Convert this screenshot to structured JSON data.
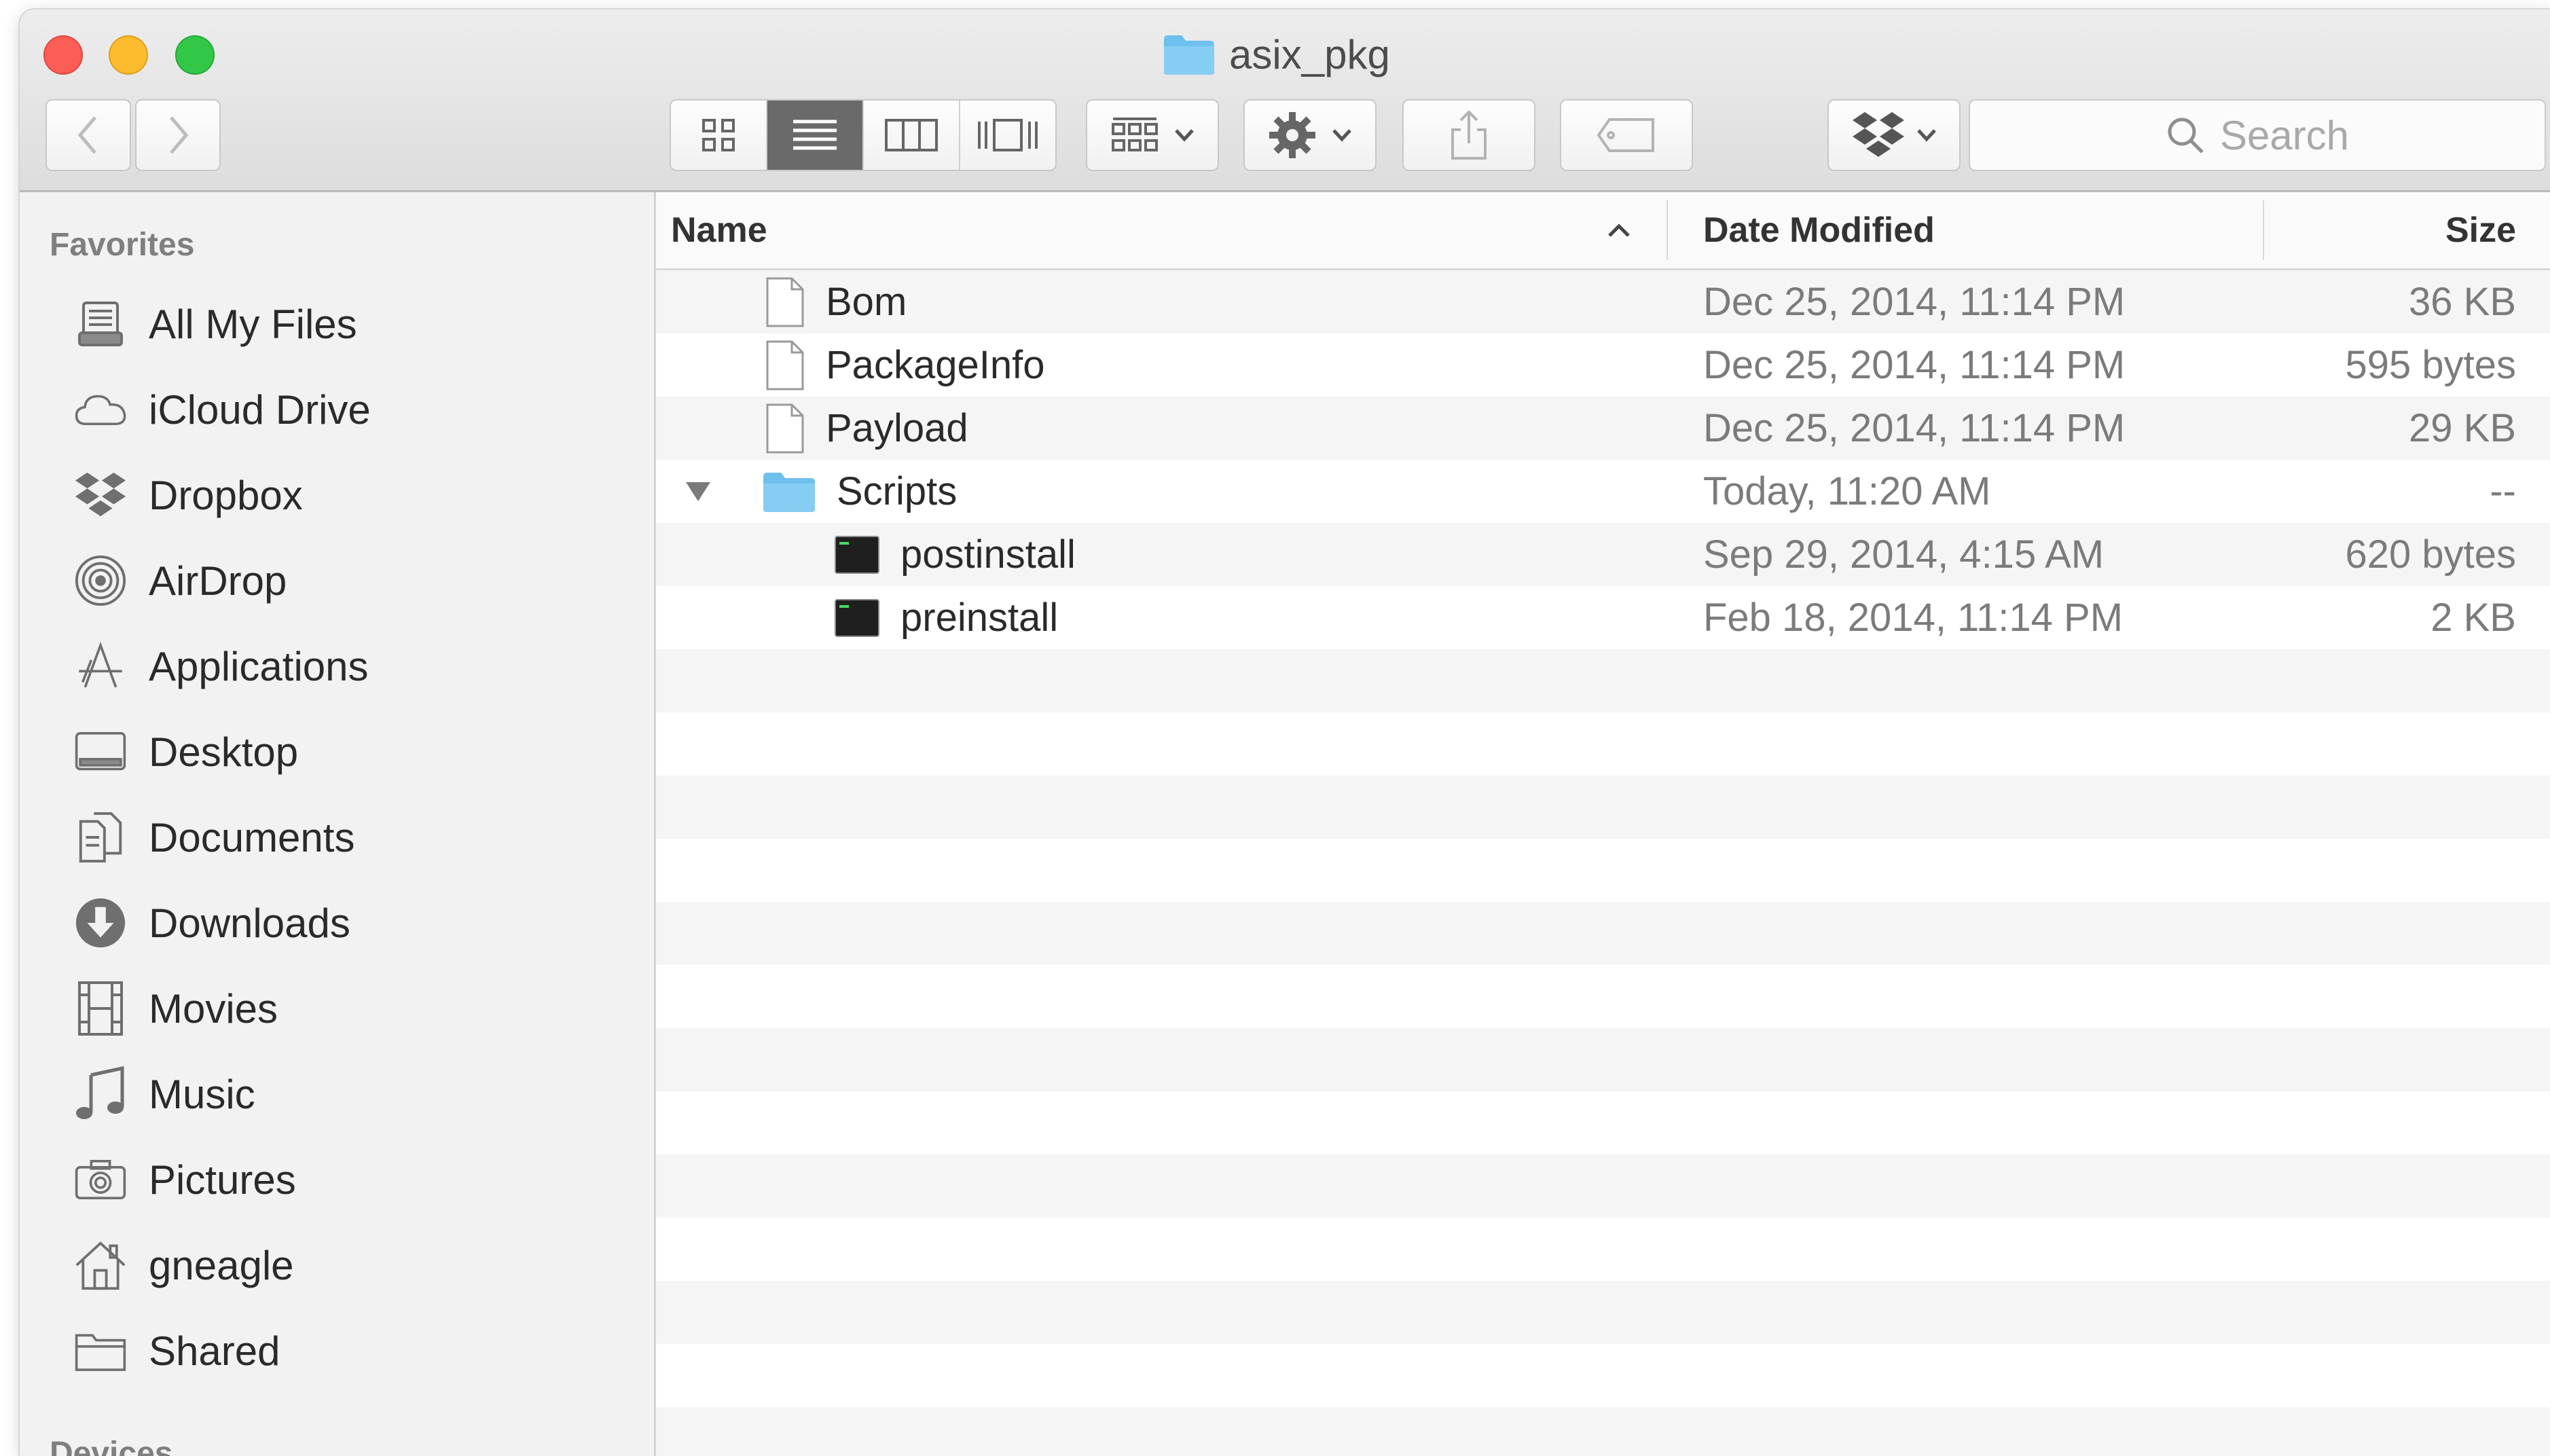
{
  "window": {
    "title": "asix_pkg",
    "folder_icon": "folder-icon",
    "accent_folder_color": "#6ec0ee"
  },
  "toolbar": {
    "back_icon": "chevron-left-icon",
    "forward_icon": "chevron-right-icon",
    "view_modes": [
      "icon-view-icon",
      "list-view-icon",
      "column-view-icon",
      "cover-flow-icon"
    ],
    "active_view": "list-view-icon",
    "arrange_icon": "arrange-icon",
    "action_icon": "gear-icon",
    "share_icon": "share-icon",
    "tag_icon": "tag-icon",
    "dropbox_icon": "dropbox-icon",
    "search_placeholder": "Search"
  },
  "sidebar": {
    "favorites_heading": "Favorites",
    "items": [
      {
        "label": "All My Files",
        "icon": "all-my-files-icon"
      },
      {
        "label": "iCloud Drive",
        "icon": "cloud-icon"
      },
      {
        "label": "Dropbox",
        "icon": "dropbox-icon"
      },
      {
        "label": "AirDrop",
        "icon": "airdrop-icon"
      },
      {
        "label": "Applications",
        "icon": "applications-icon"
      },
      {
        "label": "Desktop",
        "icon": "desktop-icon"
      },
      {
        "label": "Documents",
        "icon": "documents-icon"
      },
      {
        "label": "Downloads",
        "icon": "downloads-icon"
      },
      {
        "label": "Movies",
        "icon": "movies-icon"
      },
      {
        "label": "Music",
        "icon": "music-icon"
      },
      {
        "label": "Pictures",
        "icon": "camera-icon"
      },
      {
        "label": "gneagle",
        "icon": "home-icon"
      },
      {
        "label": "Shared",
        "icon": "shared-folder-icon"
      }
    ],
    "devices_heading": "Devices"
  },
  "columns": {
    "name": "Name",
    "date": "Date Modified",
    "size": "Size",
    "sort_icon": "chevron-up-icon"
  },
  "files": [
    {
      "name": "Bom",
      "date": "Dec 25, 2014, 11:14 PM",
      "size": "36 KB",
      "type": "document",
      "depth": 0
    },
    {
      "name": "PackageInfo",
      "date": "Dec 25, 2014, 11:14 PM",
      "size": "595 bytes",
      "type": "document",
      "depth": 0
    },
    {
      "name": "Payload",
      "date": "Dec 25, 2014, 11:14 PM",
      "size": "29 KB",
      "type": "document",
      "depth": 0
    },
    {
      "name": "Scripts",
      "date": "Today, 11:20 AM",
      "size": "--",
      "type": "folder",
      "depth": 0,
      "expanded": true
    },
    {
      "name": "postinstall",
      "date": "Sep 29, 2014, 4:15 AM",
      "size": "620 bytes",
      "type": "executable",
      "depth": 1
    },
    {
      "name": "preinstall",
      "date": "Feb 18, 2014, 11:14 PM",
      "size": "2 KB",
      "type": "executable",
      "depth": 1
    }
  ]
}
